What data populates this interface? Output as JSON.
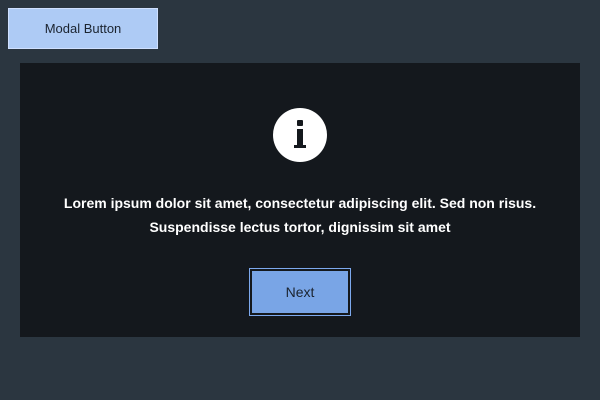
{
  "toolbar": {
    "modal_button_label": "Modal Button"
  },
  "modal": {
    "icon": "info-icon",
    "message": "Lorem ipsum dolor sit amet, consectetur adipiscing elit. Sed non risus. Suspendisse lectus tortor, dignissim sit amet",
    "next_label": "Next"
  },
  "colors": {
    "page_background": "#2b3640",
    "modal_background": "#14181d",
    "modal_button_background": "#aecbf5",
    "next_button_background": "#79a5e6",
    "text_light": "#ffffff"
  }
}
